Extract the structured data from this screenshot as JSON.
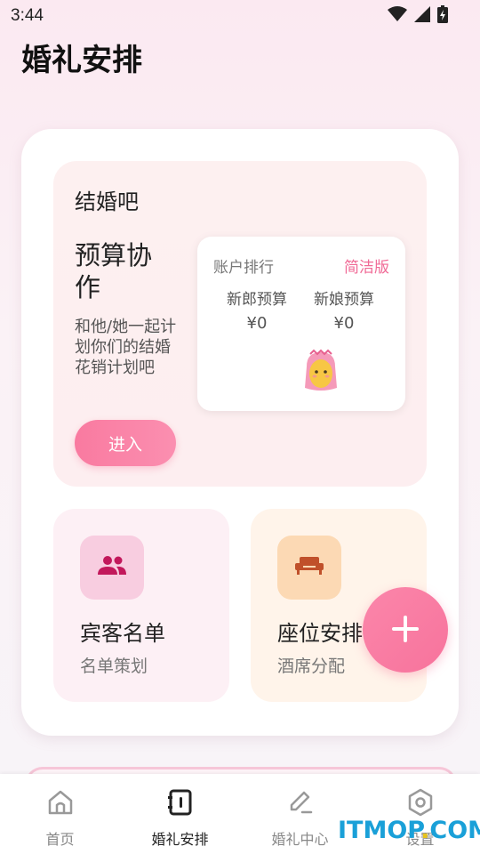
{
  "status_bar": {
    "time": "3:44",
    "icons": [
      "wifi-icon",
      "signal-icon",
      "battery-charging-icon"
    ]
  },
  "page": {
    "title": "婚礼安排"
  },
  "wedding_panel": {
    "title": "结婚吧",
    "budget_heading": "预算协作",
    "description": "和他/她一起计划你们的结婚花销计划吧",
    "enter_label": "进入",
    "ranking": {
      "title": "账户排行",
      "mode": "简洁版",
      "groom_label": "新郎预算",
      "groom_value": "¥0",
      "bride_label": "新娘预算",
      "bride_value": "¥0",
      "avatar": "bride-avatar-icon"
    }
  },
  "features": [
    {
      "title": "宾客名单",
      "subtitle": "名单策划",
      "icon": "people-icon",
      "accent": "#c2185b"
    },
    {
      "title": "座位安排",
      "subtitle": "酒席分配",
      "icon": "sofa-icon",
      "accent": "#c0502a"
    }
  ],
  "fab": {
    "icon": "plus-icon"
  },
  "nav": {
    "items": [
      {
        "label": "首页",
        "icon": "home-icon",
        "active": false
      },
      {
        "label": "婚礼安排",
        "icon": "notebook-icon",
        "active": true
      },
      {
        "label": "婚礼中心",
        "icon": "edit-icon",
        "active": false
      },
      {
        "label": "设置",
        "icon": "settings-icon",
        "active": false
      }
    ]
  },
  "watermark": {
    "brand_a": "ITMOP",
    "dot": ".",
    "brand_b": "COM"
  },
  "colors": {
    "accent": "#f77ca0",
    "active_nav": "#222222",
    "inactive_nav": "#888888"
  }
}
